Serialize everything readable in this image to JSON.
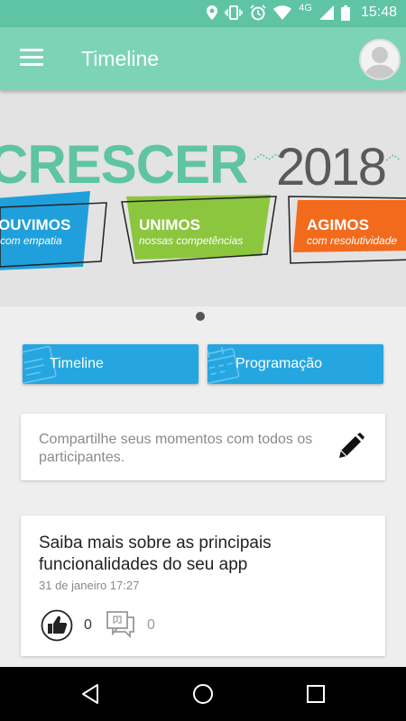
{
  "status_bar": {
    "time": "15:48",
    "network": "4G",
    "icons": [
      "location-icon",
      "vibrate-icon",
      "alarm-icon",
      "wifi-icon",
      "signal-icon",
      "battery-icon"
    ]
  },
  "app_bar": {
    "title": "Timeline",
    "menu_icon": "menu-icon",
    "avatar_icon": "avatar"
  },
  "banner": {
    "headline": "CRESCER",
    "year": "2018",
    "tags": [
      {
        "title": "OUVIMOS",
        "subtitle": "com empatia",
        "color": "#1fa0dc"
      },
      {
        "title": "UNIMOS",
        "subtitle": "nossas competências",
        "color": "#8cc63f"
      },
      {
        "title": "AGIMOS",
        "subtitle": "com resolutividade",
        "color": "#f26b1d"
      }
    ],
    "carousel_pages": 1,
    "carousel_current": 1
  },
  "actions": {
    "timeline_label": "Timeline",
    "programacao_label": "Programação"
  },
  "share": {
    "prompt": "Compartilhe seus momentos com todos os participantes."
  },
  "post": {
    "title": "Saiba mais sobre as principais funcionalidades do seu app",
    "date": "31 de janeiro 17:27",
    "likes": "0",
    "comments": "0"
  },
  "colors": {
    "status_bar": "#5fc4a4",
    "app_bar": "#7dd3b5",
    "button": "#26a6e0",
    "background": "#eeeeee"
  }
}
